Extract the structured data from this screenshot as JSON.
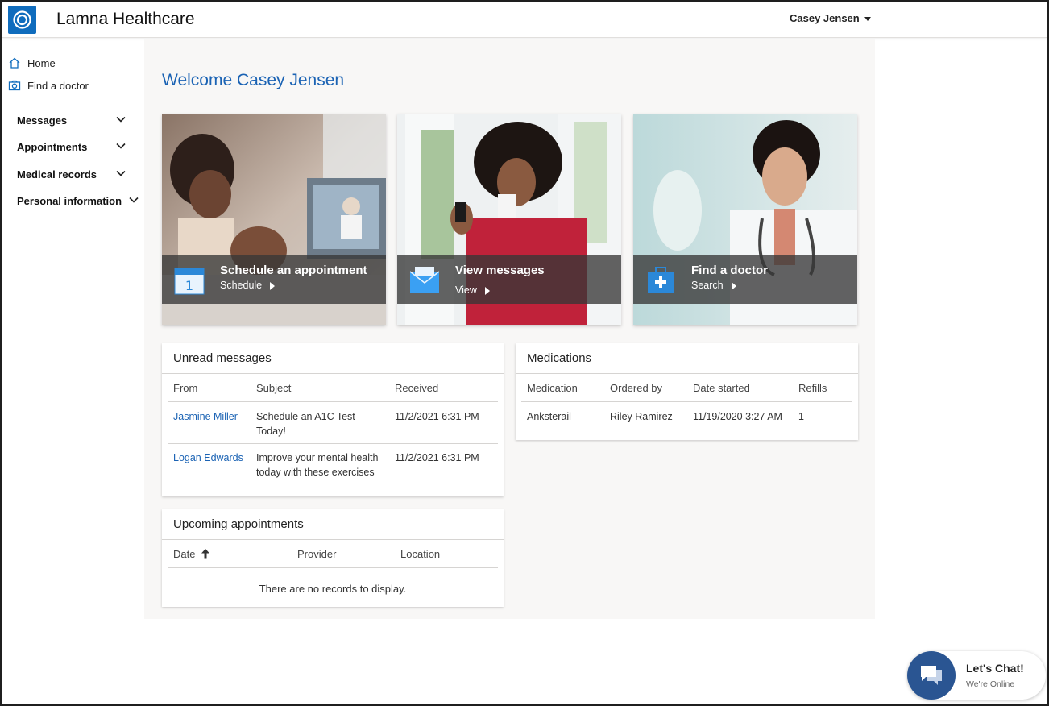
{
  "header": {
    "brand": "Lamna Healthcare",
    "user_name": "Casey Jensen"
  },
  "sidebar": {
    "links": [
      {
        "label": "Home",
        "icon": "home-icon"
      },
      {
        "label": "Find a doctor",
        "icon": "camera-icon"
      }
    ],
    "sections": [
      {
        "label": "Messages"
      },
      {
        "label": "Appointments"
      },
      {
        "label": "Medical records"
      },
      {
        "label": "Personal information"
      }
    ]
  },
  "main": {
    "welcome": "Welcome Casey Jensen",
    "tiles": [
      {
        "title": "Schedule an appointment",
        "link": "Schedule",
        "icon": "calendar-icon"
      },
      {
        "title": "View messages",
        "link": "View",
        "icon": "envelope-icon"
      },
      {
        "title": "Find a doctor",
        "link": "Search",
        "icon": "medical-kit-icon"
      }
    ]
  },
  "unread_messages": {
    "title": "Unread messages",
    "columns": [
      "From",
      "Subject",
      "Received"
    ],
    "rows": [
      {
        "from": "Jasmine Miller",
        "subject_line1": "Schedule an A1C Test",
        "subject_line2": "Today!",
        "received": "11/2/2021 6:31 PM"
      },
      {
        "from": "Logan Edwards",
        "subject_line1": "Improve your mental health",
        "subject_line2": "today with these exercises",
        "received": "11/2/2021 6:31 PM"
      }
    ]
  },
  "upcoming_appointments": {
    "title": "Upcoming appointments",
    "columns": [
      "Date",
      "Provider",
      "Location"
    ],
    "empty_text": "There are no records to display."
  },
  "medications": {
    "title": "Medications",
    "columns": [
      "Medication",
      "Ordered by",
      "Date started",
      "Refills"
    ],
    "rows": [
      {
        "medication": "Anksterail",
        "ordered_by": "Riley Ramirez",
        "date_started": "11/19/2020 3:27 AM",
        "refills": "1"
      }
    ]
  },
  "chat": {
    "title": "Let's Chat!",
    "subtitle": "We're Online",
    "icon": "chat-bubbles-icon"
  },
  "colors": {
    "accent": "#1b63b4",
    "chat": "#2a5592",
    "logo": "#0f6cbd",
    "main_bg": "#f8f7f6"
  }
}
